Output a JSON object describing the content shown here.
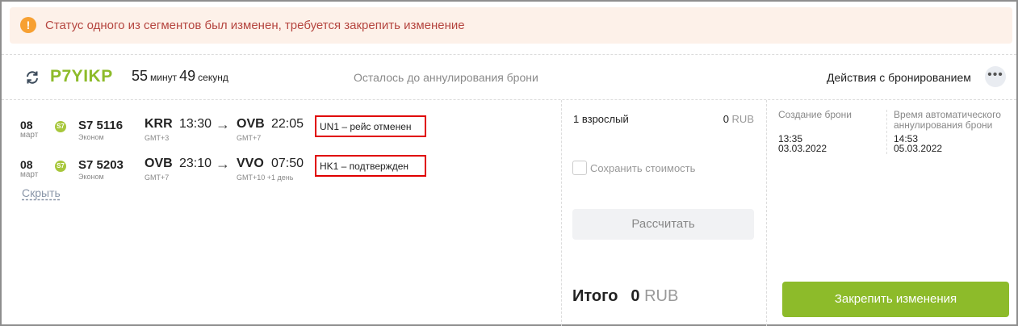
{
  "alert": {
    "icon": "exclamation-icon",
    "text": "Статус одного из сегментов был изменен, требуется закрепить изменение",
    "colors": {
      "background": "#fdf1e9",
      "text": "#b5453f",
      "icon": "#f7a032"
    }
  },
  "header": {
    "pnr": "P7YIKP",
    "timer": {
      "minutes": "55",
      "minutes_unit": "минут",
      "seconds": "49",
      "seconds_unit": "секунд"
    },
    "remaining_label": "Осталось до аннулирования брони",
    "actions_label": "Действия с бронированием",
    "more_icon": "•••"
  },
  "segments": [
    {
      "day": "08",
      "month": "март",
      "airline_logo": "S7",
      "flight": "S7 5116",
      "cabin": "Эконом",
      "from": {
        "code": "KRR",
        "time": "13:30",
        "gmt": "GMT+3"
      },
      "to": {
        "code": "OVB",
        "time": "22:05",
        "gmt": "GMT+7",
        "next_day": ""
      },
      "arrow": "→",
      "status": "UN1 – рейс отменен"
    },
    {
      "day": "08",
      "month": "март",
      "airline_logo": "S7",
      "flight": "S7 5203",
      "cabin": "Эконом",
      "from": {
        "code": "OVB",
        "time": "23:10",
        "gmt": "GMT+7"
      },
      "to": {
        "code": "VVO",
        "time": "07:50",
        "gmt": "GMT+10",
        "next_day": "+1 день"
      },
      "arrow": "→",
      "status": "HK1 – подтвержден"
    }
  ],
  "hide_link": "Скрыть",
  "pricing": {
    "passengers": "1 взрослый",
    "amount": "0",
    "currency": "RUB",
    "save_price_label": "Сохранить стоимость",
    "calculate_label": "Рассчитать",
    "total_label": "Итого",
    "total_amount": "0",
    "total_currency": "RUB"
  },
  "booking_info": {
    "created_label": "Создание брони",
    "created_time": "13:35",
    "created_date": "03.03.2022",
    "auto_cancel_label": "Время автоматического аннулирования брони",
    "auto_cancel_time": "14:53",
    "auto_cancel_date": "05.03.2022"
  },
  "commit_button": "Закрепить изменения",
  "colors": {
    "accent": "#8dbb2a",
    "status_border": "#e00000"
  }
}
